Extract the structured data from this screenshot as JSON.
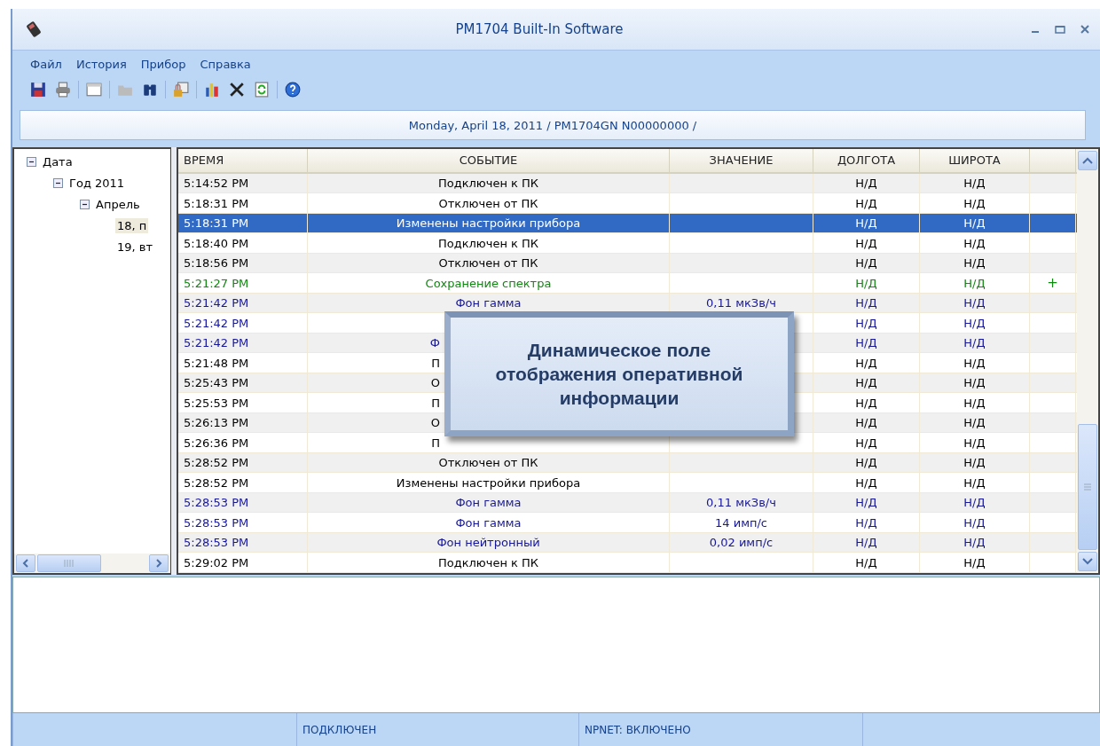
{
  "window": {
    "title": "PM1704 Built-In Software"
  },
  "menu": [
    "Файл",
    "История",
    "Прибор",
    "Справка"
  ],
  "info_bar": "Monday, April 18, 2011 / PM1704GN N00000000 /",
  "tree": [
    {
      "label": "Дата",
      "expanded": true,
      "selected": false,
      "children": [
        {
          "label": "Год 2011",
          "expanded": true,
          "selected": false,
          "children": [
            {
              "label": "Апрель",
              "expanded": true,
              "selected": false,
              "children": [
                {
                  "label": "18, п",
                  "selected": true
                },
                {
                  "label": "19, вт",
                  "selected": false
                }
              ]
            }
          ]
        }
      ]
    }
  ],
  "table": {
    "columns": [
      "ВРЕМЯ",
      "СОБЫТИЕ",
      "ЗНАЧЕНИЕ",
      "ДОЛГОТА",
      "ШИРОТА"
    ],
    "rows": [
      {
        "kind": "plain",
        "selected": false,
        "time": "5:14:52 PM",
        "event": "Подключен к ПК",
        "lon": "Н/Д",
        "lat": "Н/Д"
      },
      {
        "kind": "plain",
        "selected": false,
        "time": "5:18:31 PM",
        "event": "Отключен от ПК",
        "lon": "Н/Д",
        "lat": "Н/Д"
      },
      {
        "kind": "plain",
        "selected": true,
        "time": "5:18:31 PM",
        "event": "Изменены настройки прибора",
        "lon": "Н/Д",
        "lat": "Н/Д"
      },
      {
        "kind": "plain",
        "selected": false,
        "time": "5:18:40 PM",
        "event": "Подключен к ПК",
        "lon": "Н/Д",
        "lat": "Н/Д"
      },
      {
        "kind": "plain",
        "selected": false,
        "time": "5:18:56 PM",
        "event": "Отключен от ПК",
        "lon": "Н/Д",
        "lat": "Н/Д"
      },
      {
        "kind": "spectrum",
        "selected": false,
        "time": "5:21:27 PM",
        "event": "Сохранение спектра",
        "lon": "Н/Д",
        "lat": "Н/Д",
        "mark": "+"
      },
      {
        "kind": "measure",
        "selected": false,
        "time": "5:21:42 PM",
        "event": "Фон гамма",
        "value": "0,11 мкЗв/ч",
        "lon": "Н/Д",
        "lat": "Н/Д"
      },
      {
        "kind": "measure",
        "selected": false,
        "time": "5:21:42 PM",
        "lon": "Н/Д",
        "lat": "Н/Д"
      },
      {
        "kind": "measure",
        "selected": false,
        "time": "5:21:42 PM",
        "event": "Ф",
        "cut": true,
        "lon": "Н/Д",
        "lat": "Н/Д"
      },
      {
        "kind": "plain",
        "selected": false,
        "time": "5:21:48 PM",
        "event": "П",
        "cut": true,
        "lon": "Н/Д",
        "lat": "Н/Д"
      },
      {
        "kind": "plain",
        "selected": false,
        "time": "5:25:43 PM",
        "event": "О",
        "cut": true,
        "lon": "Н/Д",
        "lat": "Н/Д"
      },
      {
        "kind": "plain",
        "selected": false,
        "time": "5:25:53 PM",
        "event": "П",
        "cut": true,
        "lon": "Н/Д",
        "lat": "Н/Д"
      },
      {
        "kind": "plain",
        "selected": false,
        "time": "5:26:13 PM",
        "event": "О",
        "cut": true,
        "lon": "Н/Д",
        "lat": "Н/Д"
      },
      {
        "kind": "plain",
        "selected": false,
        "time": "5:26:36 PM",
        "event": "П",
        "cut": true,
        "lon": "Н/Д",
        "lat": "Н/Д"
      },
      {
        "kind": "plain",
        "selected": false,
        "time": "5:28:52 PM",
        "event": "Отключен от ПК",
        "lon": "Н/Д",
        "lat": "Н/Д"
      },
      {
        "kind": "plain",
        "selected": false,
        "time": "5:28:52 PM",
        "event": "Изменены настройки прибора",
        "lon": "Н/Д",
        "lat": "Н/Д"
      },
      {
        "kind": "measure",
        "selected": false,
        "time": "5:28:53 PM",
        "event": "Фон гамма",
        "value": "0,11 мкЗв/ч",
        "lon": "Н/Д",
        "lat": "Н/Д"
      },
      {
        "kind": "measure",
        "selected": false,
        "time": "5:28:53 PM",
        "event": "Фон гамма",
        "value": "14 имп/с",
        "lon": "Н/Д",
        "lat": "Н/Д"
      },
      {
        "kind": "measure",
        "selected": false,
        "time": "5:28:53 PM",
        "event": "Фон нейтронный",
        "value": "0,02 имп/с",
        "lon": "Н/Д",
        "lat": "Н/Д"
      },
      {
        "kind": "plain",
        "selected": false,
        "time": "5:29:02 PM",
        "event": "Подключен к ПК",
        "lon": "Н/Д",
        "lat": "Н/Д"
      }
    ]
  },
  "callout": "Динамическое поле отображения оперативной информации",
  "status_bar": [
    "ПОДКЛЮЧЕН",
    "NPNET: ВКЛЮЧЕНО"
  ]
}
